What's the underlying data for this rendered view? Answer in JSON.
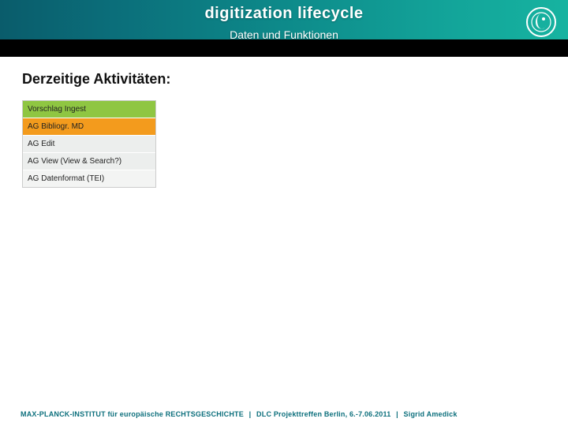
{
  "header": {
    "title": "digitization lifecycle",
    "subtitle": "Daten und Funktionen"
  },
  "logo_name": "max-planck-minerva-logo",
  "section": {
    "heading": "Derzeitige Aktivitäten:",
    "items": [
      {
        "label": "Vorschlag Ingest",
        "bg": "#8fc642"
      },
      {
        "label": "AG Bibliogr. MD",
        "bg": "#f39b1d"
      },
      {
        "label": "AG Edit",
        "bg": "#eceeed"
      },
      {
        "label": "AG View (View & Search?)",
        "bg": "#eceeed"
      },
      {
        "label": "AG Datenformat (TEI)",
        "bg": "#f3f4f3"
      }
    ]
  },
  "footer": {
    "org": "MAX-PLANCK-INSTITUT für europäische RECHTSGESCHICHTE",
    "event": "DLC Projekttreffen Berlin, 6.-7.06.2011",
    "author": "Sigrid Amedick",
    "sep": "|"
  }
}
